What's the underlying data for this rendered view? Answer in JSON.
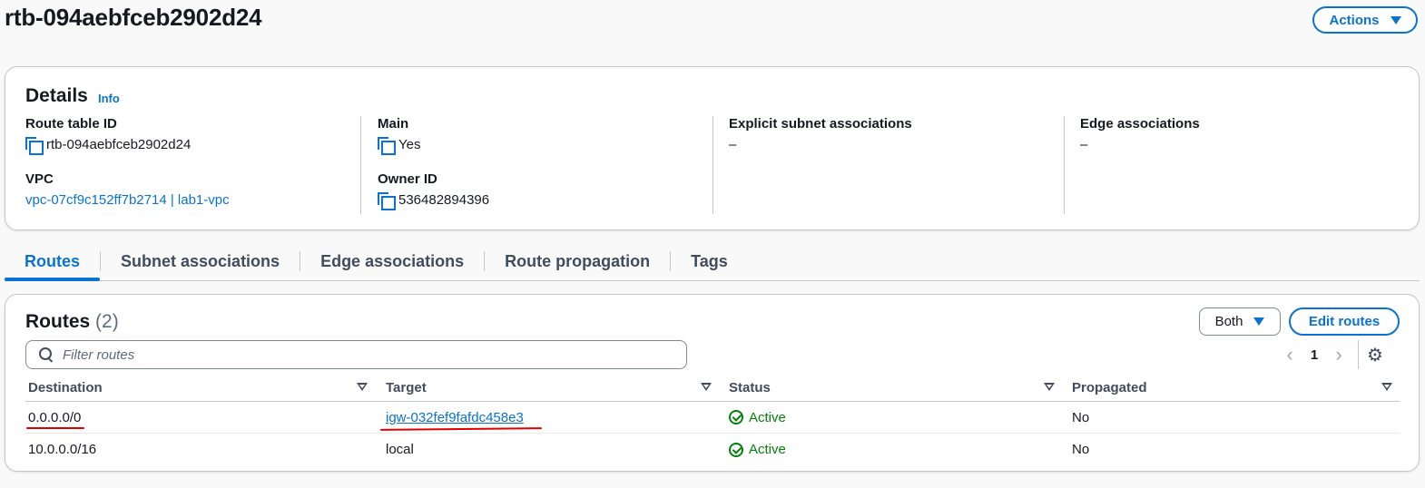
{
  "header": {
    "title": "rtb-094aebfceb2902d24",
    "actions_label": "Actions"
  },
  "details": {
    "heading": "Details",
    "info_label": "Info",
    "route_table_id": {
      "label": "Route table ID",
      "value": "rtb-094aebfceb2902d24"
    },
    "vpc": {
      "label": "VPC",
      "value": "vpc-07cf9c152ff7b2714 | lab1-vpc"
    },
    "main": {
      "label": "Main",
      "value": "Yes"
    },
    "owner_id": {
      "label": "Owner ID",
      "value": "536482894396"
    },
    "explicit_subnet_associations": {
      "label": "Explicit subnet associations",
      "value": "–"
    },
    "edge_associations": {
      "label": "Edge associations",
      "value": "–"
    }
  },
  "tabs": [
    {
      "label": "Routes",
      "active": true
    },
    {
      "label": "Subnet associations",
      "active": false
    },
    {
      "label": "Edge associations",
      "active": false
    },
    {
      "label": "Route propagation",
      "active": false
    },
    {
      "label": "Tags",
      "active": false
    }
  ],
  "routes": {
    "heading": "Routes",
    "count": "(2)",
    "filter_select": "Both",
    "edit_label": "Edit routes",
    "search_placeholder": "Filter routes",
    "page": "1",
    "columns": [
      "Destination",
      "Target",
      "Status",
      "Propagated"
    ],
    "rows": [
      {
        "destination": "0.0.0.0/0",
        "target": "igw-032fef9fafdc458e3",
        "target_is_link": true,
        "status": "Active",
        "propagated": "No"
      },
      {
        "destination": "10.0.0.0/16",
        "target": "local",
        "target_is_link": false,
        "status": "Active",
        "propagated": "No"
      }
    ]
  },
  "colors": {
    "accent": "#0972d3",
    "success": "#037f0c",
    "annotation": "#e00000"
  },
  "icons": [
    "copy-icon",
    "search-icon",
    "chevron-left-icon",
    "chevron-right-icon",
    "gear-icon",
    "status-success-icon",
    "caret-down-icon",
    "sort-icon"
  ]
}
